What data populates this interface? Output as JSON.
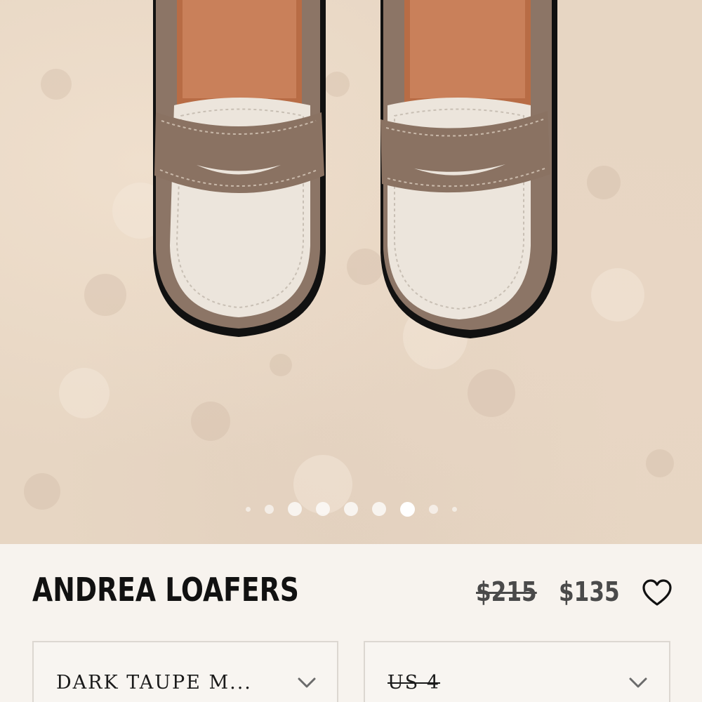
{
  "product": {
    "title": "ANDREA LOAFERS",
    "price_original": "$215",
    "price_sale": "$135"
  },
  "carousel": {
    "total_dots": 9,
    "active_index": 6
  },
  "selectors": {
    "color_value": "DARK TAUPE M...",
    "size_value": "US 4"
  },
  "icons": {
    "wishlist": "heart-outline-icon",
    "dropdown": "chevron-down-icon"
  },
  "colors": {
    "text_primary": "#111111",
    "price": "#4a4a4a",
    "panel_background": "#f7f3ee",
    "border": "#dcd7d1"
  }
}
